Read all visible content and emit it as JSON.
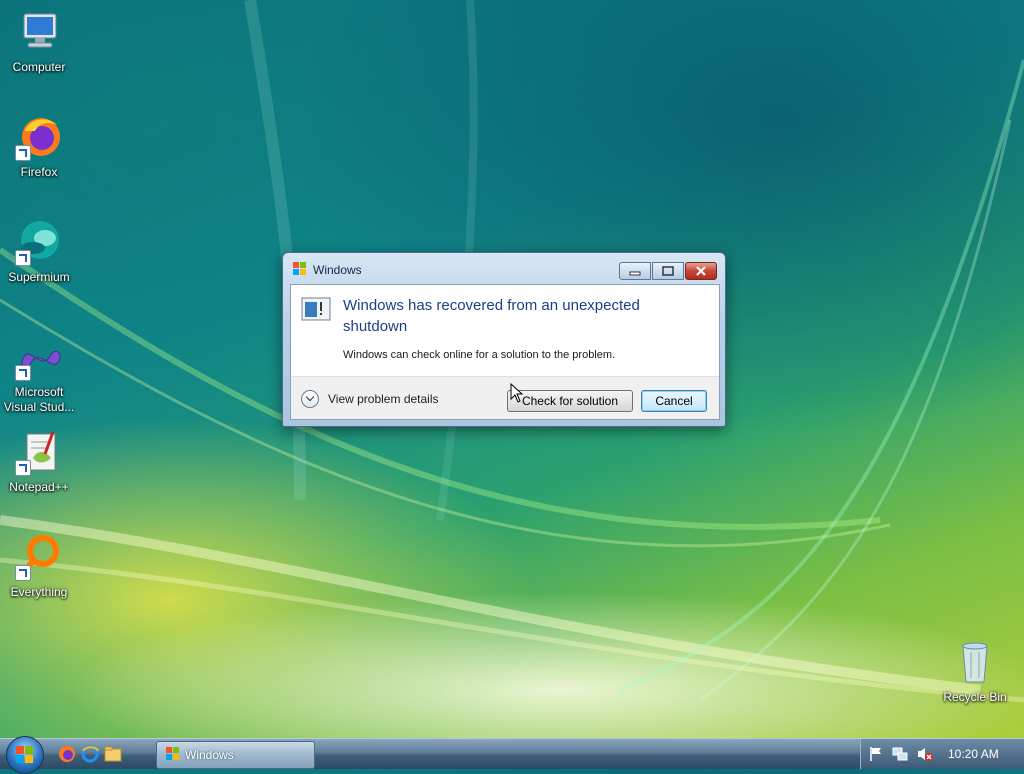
{
  "desktop": {
    "icons": [
      {
        "label": "Computer"
      },
      {
        "label": "Firefox"
      },
      {
        "label": "Supermium"
      },
      {
        "label": "Microsoft Visual Stud..."
      },
      {
        "label": "Notepad++"
      },
      {
        "label": "Everything"
      },
      {
        "label": "Recycle Bin"
      }
    ]
  },
  "dialog": {
    "title": "Windows",
    "heading": "Windows has recovered from an unexpected shutdown",
    "message": "Windows can check online for a solution to the problem.",
    "details_label": "View problem details",
    "check_button": "Check for solution",
    "cancel_button": "Cancel"
  },
  "taskbar": {
    "window_button": "Windows",
    "clock": "10:20 AM"
  },
  "colors": {
    "heading": "#1b3e8a",
    "taskbar": "#3f5f7a"
  },
  "icons": {
    "start": "windows-orb-icon",
    "quick_launch": [
      "firefox-icon",
      "internet-explorer-icon",
      "explorer-folder-icon"
    ],
    "tray": [
      "action-center-flag-icon",
      "network-icon",
      "volume-muted-icon"
    ]
  }
}
